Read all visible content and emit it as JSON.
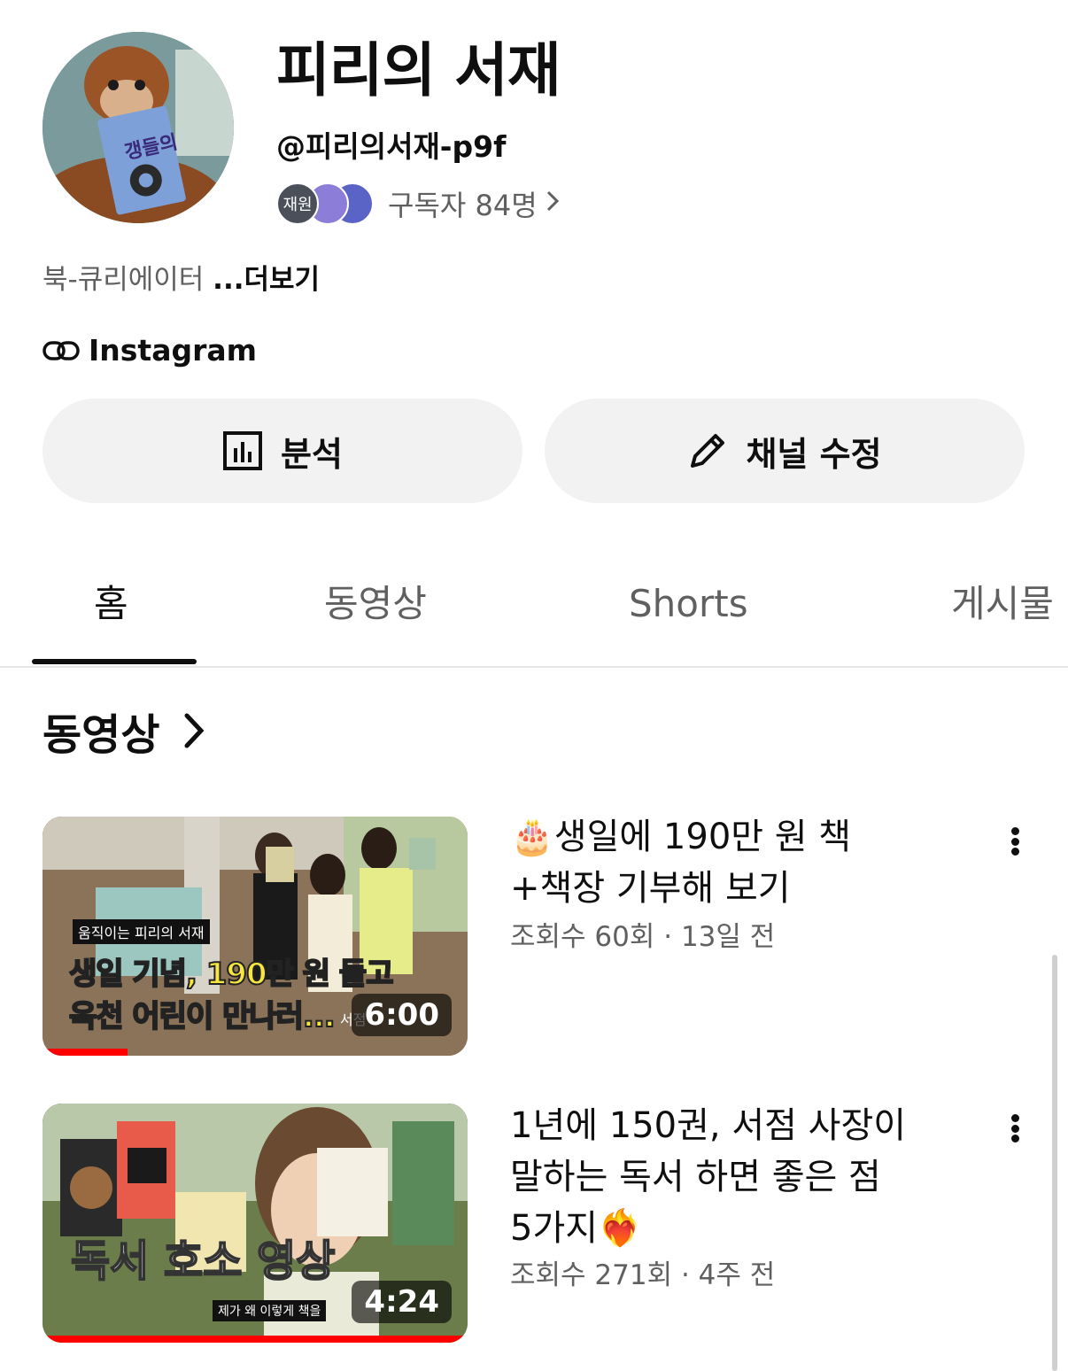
{
  "channel": {
    "name": "피리의 서재",
    "handle": "@피리의서재-p9f",
    "subscriber_avatar_label": "재원",
    "subscribers": "구독자 84명",
    "description": "북-큐리에이터",
    "more": "...더보기",
    "link_label": "Instagram",
    "avatar_book_text": "갱들의"
  },
  "buttons": {
    "analytics": "분석",
    "edit_channel": "채널 수정"
  },
  "tabs": [
    "홈",
    "동영상",
    "Shorts",
    "게시물"
  ],
  "section": {
    "title": "동영상"
  },
  "videos": [
    {
      "title_line1": "🎂생일에 190만 원 책",
      "title_line2": "+책장 기부해 보기",
      "meta": "조회수 60회 · 13일 전",
      "duration": "6:00",
      "watched_fraction": 0.2,
      "thumb_caption": "움직이는 피리의 서재",
      "thumb_line1": "생일 기념, 190만 원 들고",
      "thumb_line2": "옥천 어린이 만나러...",
      "thumb_corner": "서점"
    },
    {
      "title_line1": "1년에 150권, 서점 사장이",
      "title_line2": "말하는 독서 하면 좋은 점",
      "title_line3": "5가지❤️‍🔥",
      "meta": "조회수 271회 · 4주 전",
      "duration": "4:24",
      "watched_fraction": 1.0,
      "thumb_main": "독서 호소 영상",
      "thumb_sub": "제가 왜 이렇게 책을"
    }
  ],
  "colors": {
    "text_primary": "#0f0f0f",
    "text_secondary": "#606060",
    "button_bg": "#f2f2f2",
    "progress": "#ff0000"
  }
}
